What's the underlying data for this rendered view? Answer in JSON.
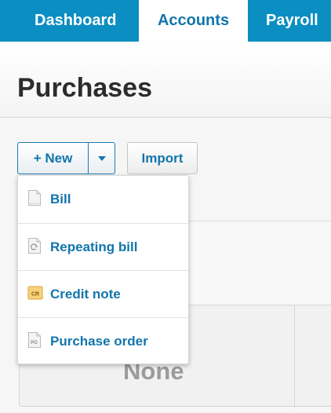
{
  "nav": {
    "tabs": [
      {
        "label": "Dashboard"
      },
      {
        "label": "Accounts",
        "active": true
      },
      {
        "label": "Payroll"
      }
    ],
    "accent": "#0b8ec2"
  },
  "page": {
    "title": "Purchases"
  },
  "toolbar": {
    "new_label": "+ New",
    "import_label": "Import"
  },
  "dropdown": {
    "items": [
      {
        "label": "Bill",
        "icon": "document-icon"
      },
      {
        "label": "Repeating bill",
        "icon": "repeat-document-icon"
      },
      {
        "label": "Credit note",
        "icon": "credit-note-icon",
        "icon_text": "CR"
      },
      {
        "label": "Purchase order",
        "icon": "purchase-order-icon",
        "icon_text": "PO"
      }
    ]
  },
  "summary": {
    "value": "None"
  },
  "colors": {
    "link": "#1275ab",
    "nav": "#0b8ec2"
  }
}
